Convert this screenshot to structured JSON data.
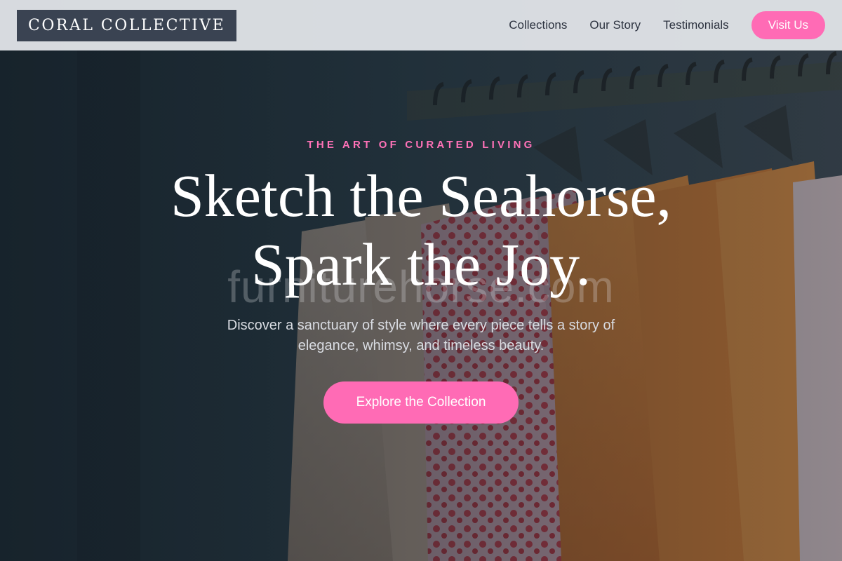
{
  "nav": {
    "brand": "CORAL COLLECTIVE",
    "links": [
      "Collections",
      "Our Story",
      "Testimonials"
    ],
    "cta": "Visit Us"
  },
  "hero": {
    "eyebrow": "THE ART OF CURATED LIVING",
    "headline_line1": "Sketch the Seahorse,",
    "headline_line2": "Spark the Joy.",
    "watermark": "furniturehorse.com",
    "subtitle": "Discover a sanctuary of style where every piece tells a story of elegance, whimsy, and timeless beauty.",
    "cta": "Explore the Collection",
    "background_image": "clothing rack with hanging garments"
  },
  "colors": {
    "accent": "#ff6bb5",
    "eyebrow": "#ff72b8",
    "brand_bg": "#3a4352",
    "nav_bg": "#e2e5e9"
  }
}
